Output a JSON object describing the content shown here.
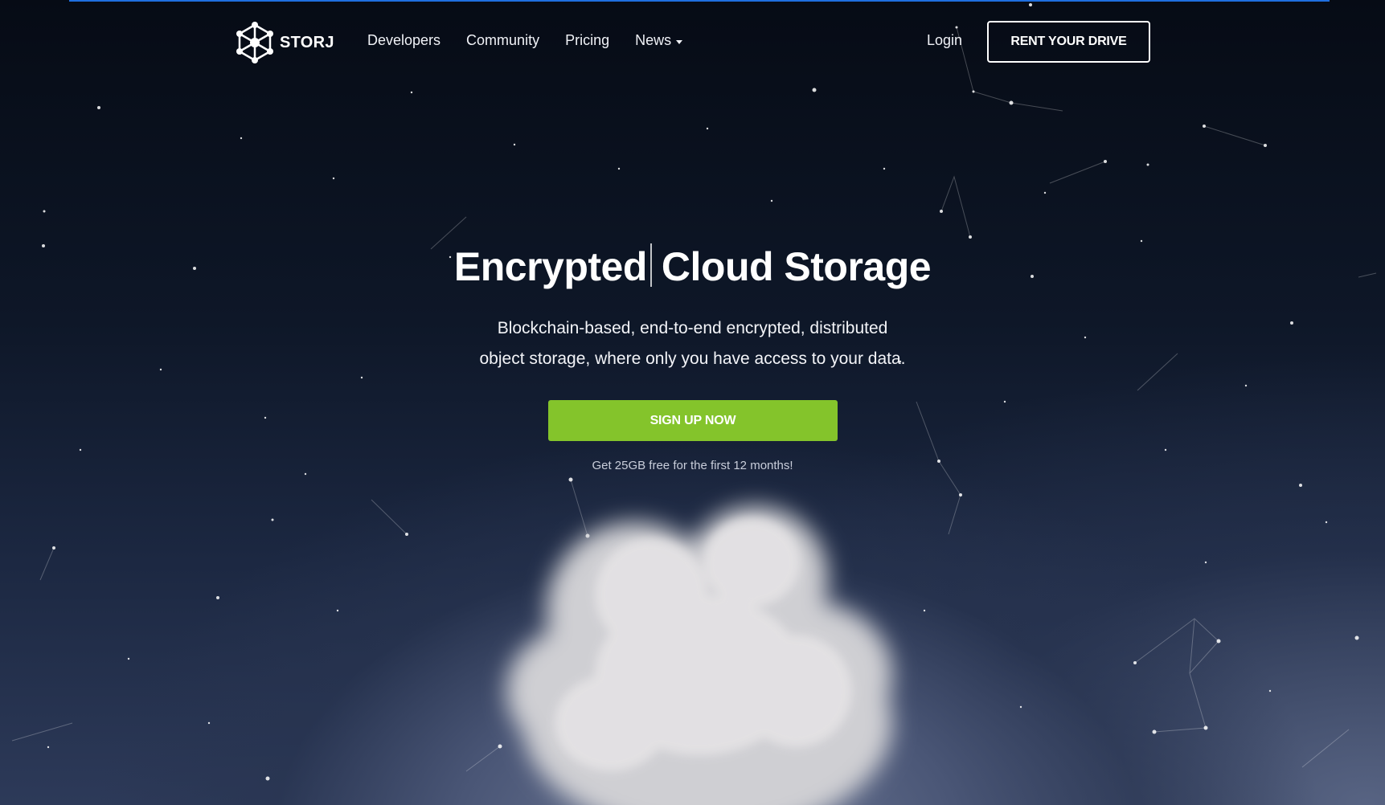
{
  "brand": {
    "name": "STORJ",
    "accent_color": "#84c42b",
    "topline_color": "#1f6fe0"
  },
  "nav": {
    "links": [
      "Developers",
      "Community",
      "Pricing",
      "News"
    ],
    "news_dropdown_icon": "caret-down-icon",
    "login_label": "Login",
    "rent_button_label": "RENT YOUR DRIVE"
  },
  "hero": {
    "title_left": "Encrypted",
    "title_right": "Cloud Storage",
    "subtitle_line1": "Blockchain-based, end-to-end encrypted, distributed",
    "subtitle_line2": "object storage, where only you have access to your data.",
    "signup_label": "SIGN UP NOW",
    "free_note": "Get 25GB free for the first 12 months!"
  }
}
